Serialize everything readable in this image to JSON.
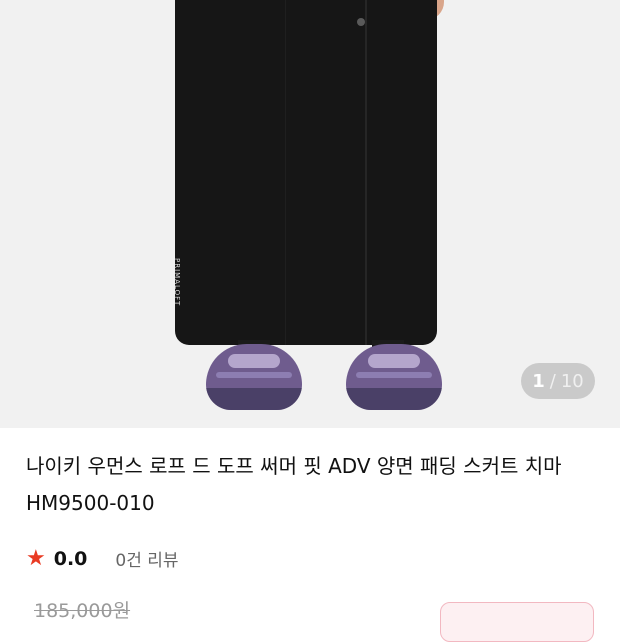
{
  "gallery": {
    "current": "1",
    "separator": "/",
    "total": "10",
    "print_text": "PRIMALOFT"
  },
  "product": {
    "title": "나이키 우먼스 로프 드 도프 써머 핏 ADV 양면 패딩 스커트 치마 HM9500-010",
    "rating": "0.0",
    "review_count": "0건 리뷰",
    "original_price": "185,000원"
  },
  "colors": {
    "star": "#e93b23",
    "button_border": "#f2b8c1"
  },
  "icons": {
    "rating": "star-icon"
  }
}
